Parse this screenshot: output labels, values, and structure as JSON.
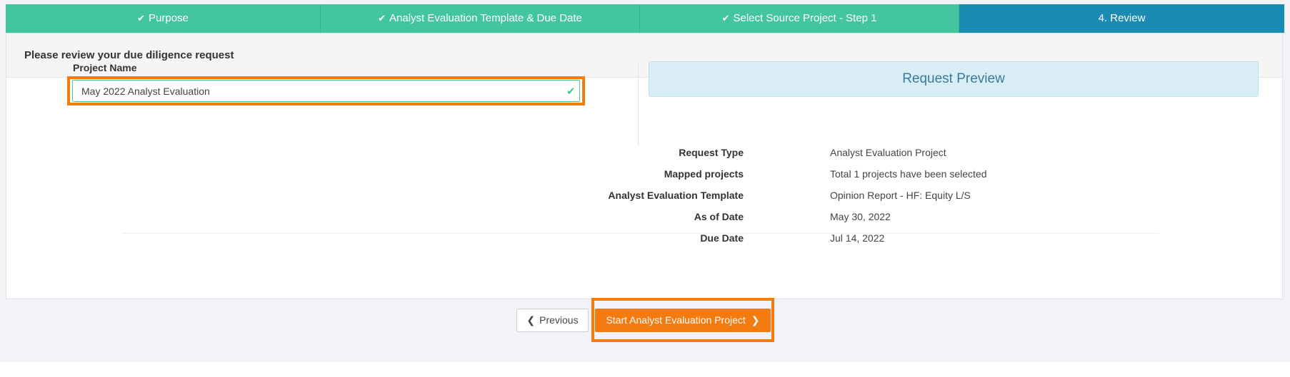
{
  "steps": [
    {
      "label": "Purpose",
      "done": true
    },
    {
      "label": "Analyst Evaluation Template & Due Date",
      "done": true
    },
    {
      "label": "Select Source Project - Step 1",
      "done": true
    },
    {
      "label": "4. Review",
      "done": false,
      "active": true
    }
  ],
  "card": {
    "title": "Please review your due diligence request"
  },
  "project_name": {
    "label": "Project Name",
    "value": "May 2022 Analyst Evaluation"
  },
  "preview": {
    "title": "Request Preview",
    "rows": [
      {
        "label": "Request Type",
        "value": "Analyst Evaluation Project"
      },
      {
        "label": "Mapped projects",
        "value": "Total 1 projects have been selected"
      },
      {
        "label": "Analyst Evaluation Template",
        "value": "Opinion Report - HF: Equity L/S"
      },
      {
        "label": "As of Date",
        "value": "May 30, 2022"
      },
      {
        "label": "Due Date",
        "value": "Jul 14, 2022"
      }
    ]
  },
  "buttons": {
    "previous": "Previous",
    "start": "Start Analyst Evaluation Project"
  },
  "colors": {
    "step_done": "#43c59e",
    "step_active": "#1a8bb3",
    "highlight": "#f47b0f",
    "primary_button": "#f47b0f"
  },
  "icons": {
    "step_done": "check-icon",
    "input_valid": "check-icon",
    "previous": "chevron-left-icon",
    "next": "chevron-right-icon"
  }
}
